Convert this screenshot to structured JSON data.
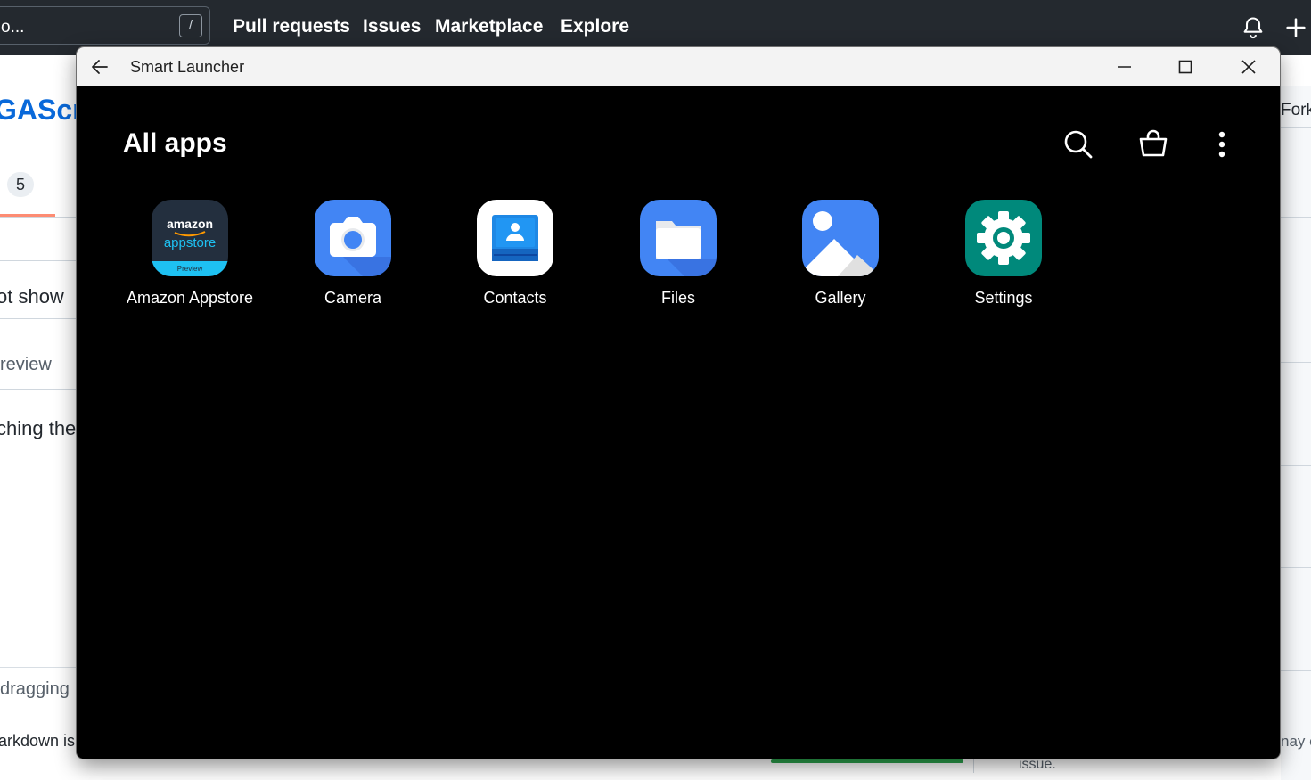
{
  "background": {
    "header": {
      "search_text": "o...",
      "search_shortcut": "/",
      "nav": [
        "Pull requests",
        "Issues",
        "Marketplace",
        "Explore"
      ]
    },
    "repo_title": "GAScrip",
    "tab_count": "5",
    "fork_label": "Fork",
    "texts": [
      "ot show",
      "review",
      "ching the",
      "dragging",
      "arkdown is",
      "nay c",
      "issue."
    ]
  },
  "window": {
    "title": "Smart Launcher"
  },
  "launcher": {
    "heading": "All apps",
    "apps": [
      {
        "label": "Amazon Appstore",
        "icon": "amazon-appstore-icon"
      },
      {
        "label": "Camera",
        "icon": "camera-icon"
      },
      {
        "label": "Contacts",
        "icon": "contacts-icon"
      },
      {
        "label": "Files",
        "icon": "folder-icon"
      },
      {
        "label": "Gallery",
        "icon": "gallery-icon"
      },
      {
        "label": "Settings",
        "icon": "gear-icon"
      }
    ],
    "amazon_icon_text": {
      "line1": "amazon",
      "line2": "appstore",
      "badge": "Preview"
    }
  },
  "colors": {
    "launcher_bg": "#000000",
    "camera_blue": "#4285f4",
    "settings_teal": "#00897b",
    "contacts_blue": "#1e88e5",
    "amazon_dark": "#232f3e",
    "amazon_accent": "#1ec1f2"
  }
}
